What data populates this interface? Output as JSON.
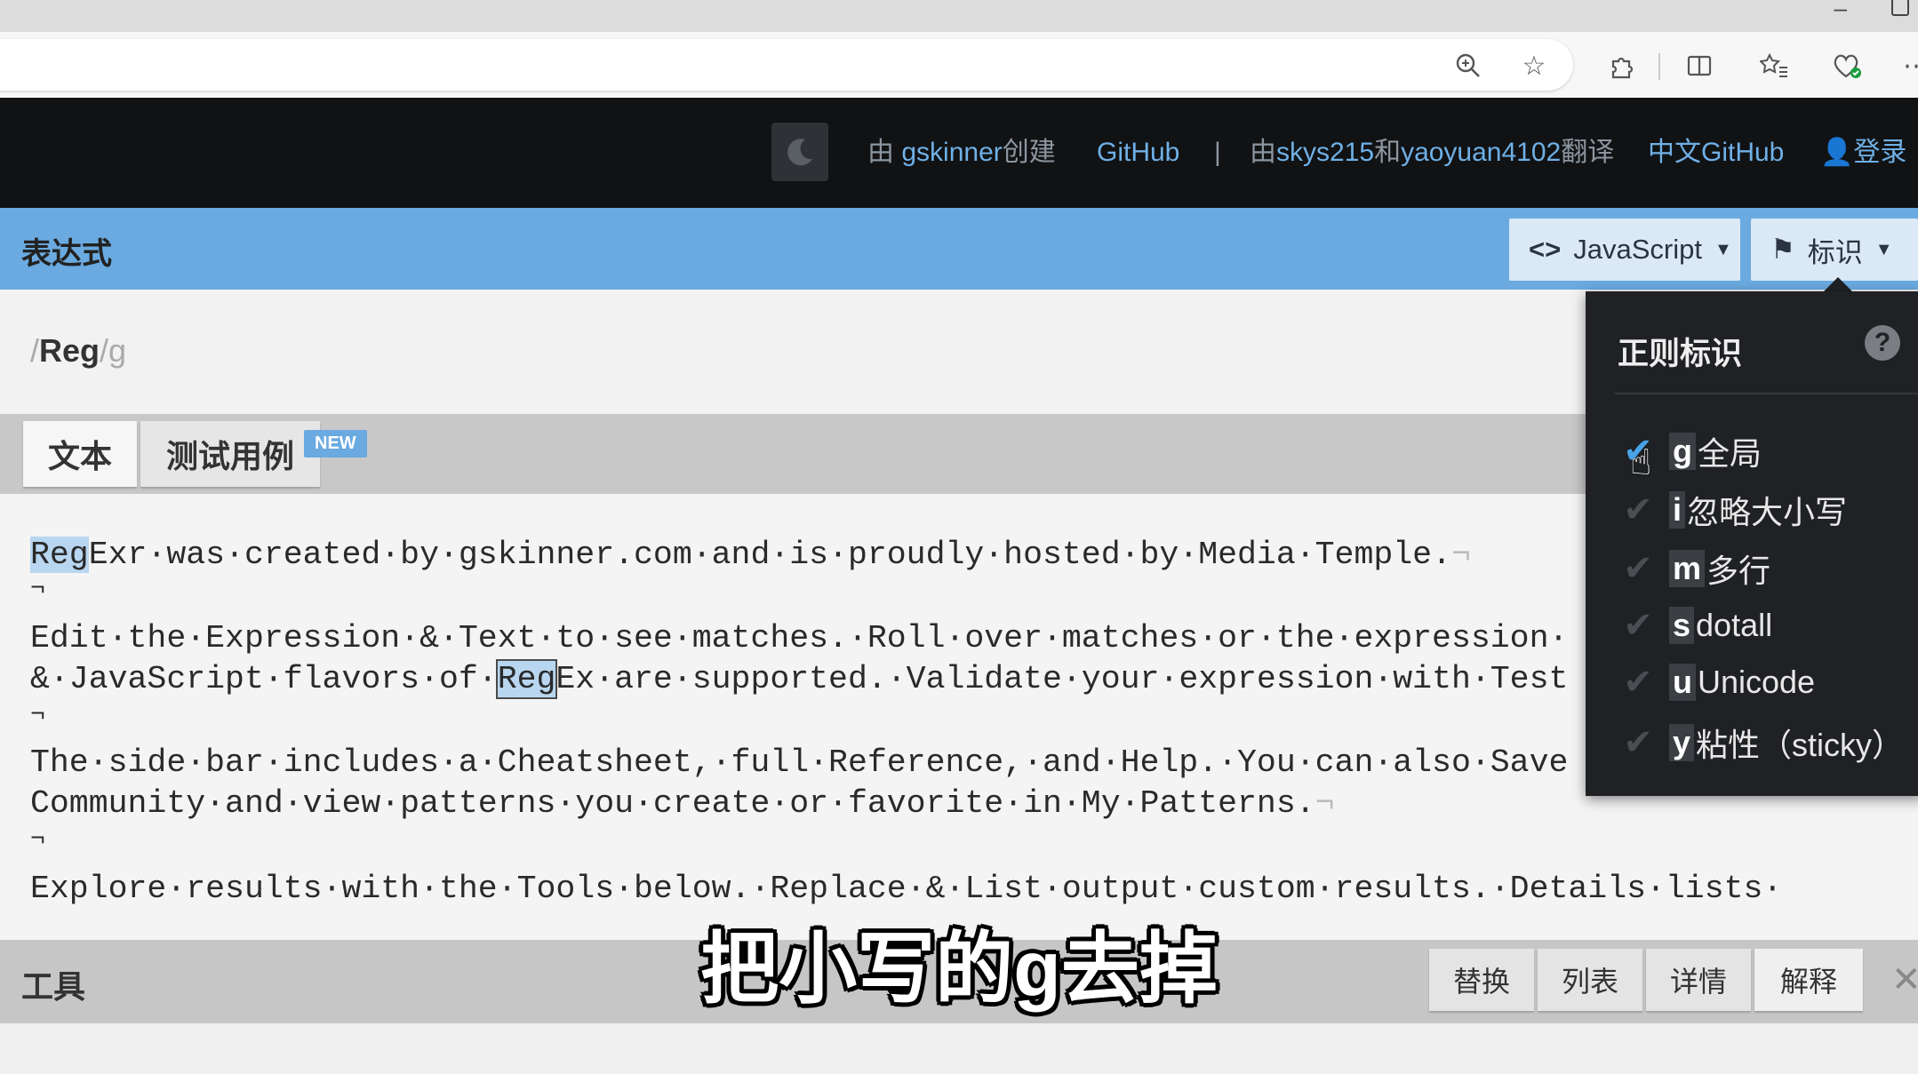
{
  "header": {
    "created_prefix": "由",
    "creator": "gskinner",
    "created_suffix": "创建",
    "github": "GitHub",
    "divider": "|",
    "translated_prefix": "由",
    "translator1": "skys215",
    "translated_and": "和",
    "translator2": "yaoyuan4102",
    "translated_suffix": "翻译",
    "chinese_github": "中文GitHub",
    "login": "登录"
  },
  "expression": {
    "section_title": "表达式",
    "lang_label": "JavaScript",
    "flags_label": "标识",
    "slash_open": "/",
    "pattern": "Reg",
    "slash_close": "/",
    "flags": "g"
  },
  "tabs": {
    "text": "文本",
    "tests": "测试用例",
    "new_badge": "NEW"
  },
  "text_lines": {
    "l1_match": "Reg",
    "l1_rest": "Exr·was·created·by·gskinner.com·and·is·proudly·hosted·by·Media·Temple.",
    "l1_end": "¬",
    "l2": "¬",
    "l3": "Edit·the·Expression·&·Text·to·see·matches.·Roll·over·matches·or·the·expression·",
    "l4_pre": "&·JavaScript·flavors·of·",
    "l4_match": "Reg",
    "l4_rest": "Ex·are·supported.·Validate·your·expression·with·Test",
    "l5": "¬",
    "l6": "The·side·bar·includes·a·Cheatsheet,·full·Reference,·and·Help.·You·can·also·Save",
    "l7": "Community·and·view·patterns·you·create·or·favorite·in·My·Patterns.",
    "l7_end": "¬",
    "l8": "¬",
    "l9": "Explore·results·with·the·Tools·below.·Replace·&·List·output·custom·results.·Details·lists·"
  },
  "tools": {
    "title": "工具",
    "tabs": [
      "替换",
      "列表",
      "详情",
      "解释"
    ],
    "close": "✕"
  },
  "flags_popup": {
    "title": "正则标识",
    "help": "?",
    "items": [
      {
        "key": "g",
        "label": "全局",
        "checked": true
      },
      {
        "key": "i",
        "label": "忽略大小写",
        "checked": false
      },
      {
        "key": "m",
        "label": "多行",
        "checked": false
      },
      {
        "key": "s",
        "label": "dotall",
        "checked": false
      },
      {
        "key": "u",
        "label": "Unicode",
        "checked": false
      },
      {
        "key": "y",
        "label": "粘性（sticky）",
        "checked": false
      }
    ]
  },
  "subtitle": "把小写的g去掉",
  "colors": {
    "accent_blue": "#6aaae0",
    "header_dark": "#111214",
    "popup_dark": "#1f2124",
    "match_highlight": "#b8d6f0",
    "check_on": "#4aa3e8"
  }
}
